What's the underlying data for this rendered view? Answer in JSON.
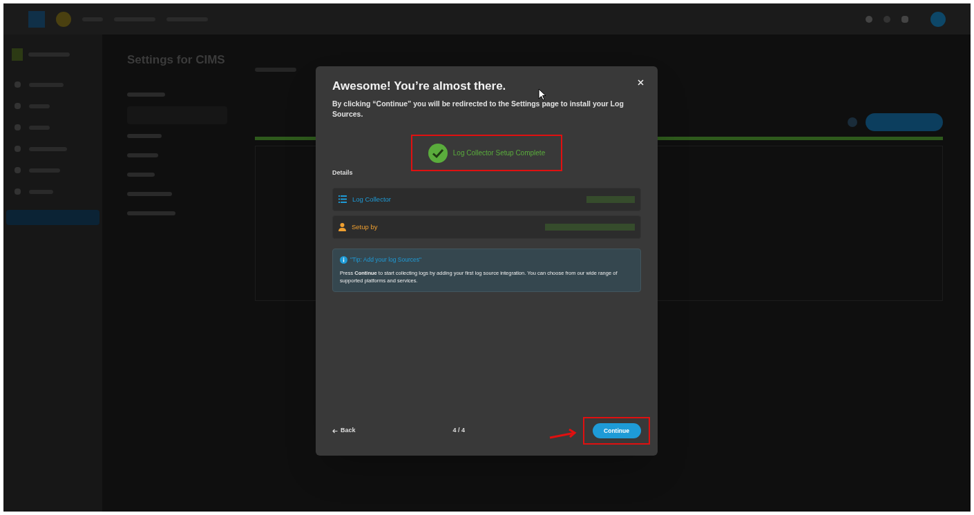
{
  "page": {
    "title": "Settings for CIMS"
  },
  "modal": {
    "title": "Awesome! You’re almost there.",
    "subtitle": "By clicking “Continue” you will be redirected to the Settings page to install your Log Sources.",
    "status": "Log Collector Setup Complete",
    "details_label": "Details",
    "details": [
      {
        "kind": "list",
        "label": "Log Collector"
      },
      {
        "kind": "user",
        "label": "Setup by"
      }
    ],
    "tip": {
      "title": "\"Tip: Add your log Sources\"",
      "body": "Press **Continue** to start collecting logs by adding your first log source integration. You can choose from our wide range of supported platforms and services."
    },
    "back": "Back",
    "step": "4 / 4",
    "continue": "Continue"
  }
}
